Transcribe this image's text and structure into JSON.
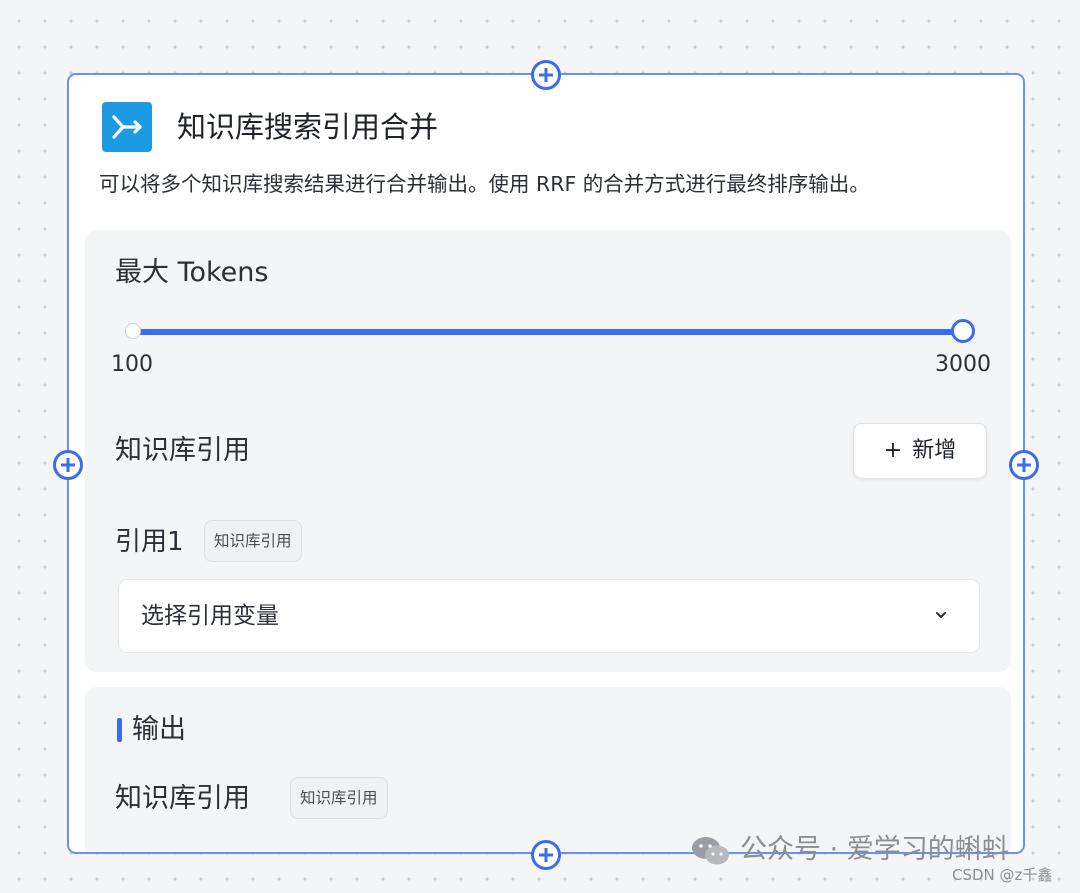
{
  "node": {
    "title": "知识库搜索引用合并",
    "description": "可以将多个知识库搜索结果进行合并输出。使用 RRF 的合并方式进行最终排序输出。",
    "icon": "merge-icon",
    "accent_color": "#3a6cf0",
    "icon_color": "#1c9be3"
  },
  "settings": {
    "max_tokens_label": "最大 Tokens",
    "slider": {
      "min_label": "100",
      "max_label": "3000",
      "value": 3000
    },
    "kb_reference_label": "知识库引用",
    "add_button_label": "新增",
    "reference": {
      "label": "引用1",
      "tag": "知识库引用",
      "select_placeholder": "选择引用变量"
    }
  },
  "output": {
    "section_label": "输出",
    "item_label": "知识库引用",
    "item_tag": "知识库引用"
  },
  "watermark": {
    "text": "公众号 · 爱学习的蝌蚪",
    "csdn": "CSDN @z千鑫"
  }
}
